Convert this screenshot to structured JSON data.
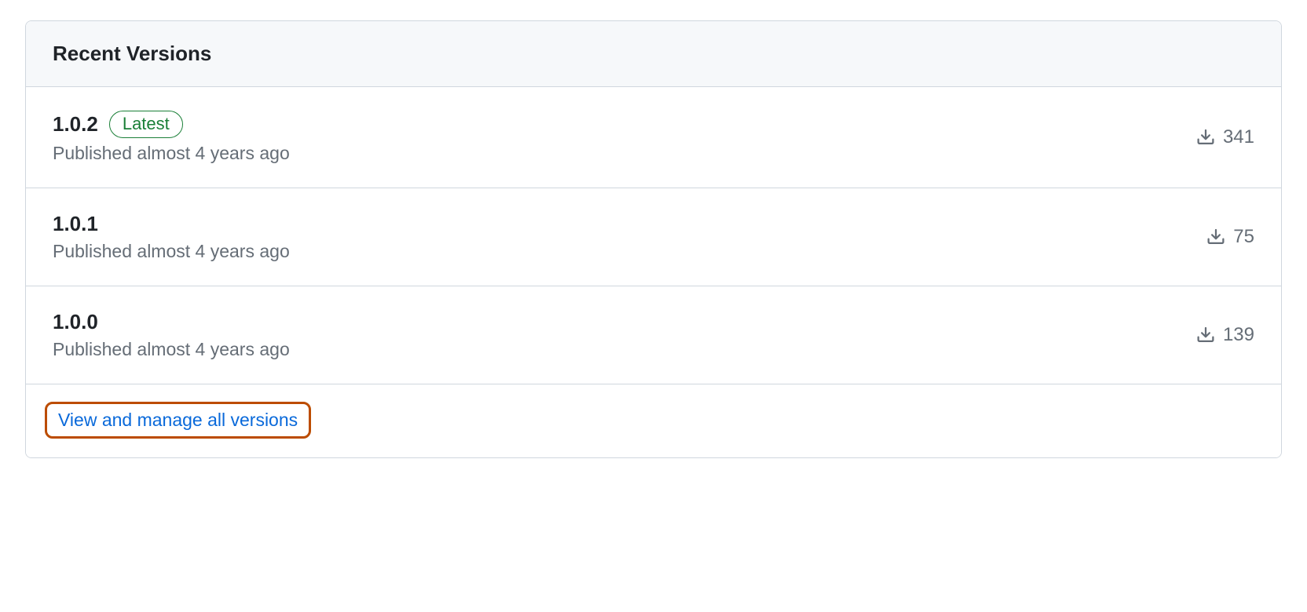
{
  "panel": {
    "title": "Recent Versions",
    "versions": [
      {
        "number": "1.0.2",
        "is_latest": true,
        "latest_label": "Latest",
        "published": "Published almost 4 years ago",
        "downloads": "341"
      },
      {
        "number": "1.0.1",
        "is_latest": false,
        "published": "Published almost 4 years ago",
        "downloads": "75"
      },
      {
        "number": "1.0.0",
        "is_latest": false,
        "published": "Published almost 4 years ago",
        "downloads": "139"
      }
    ],
    "view_all_label": "View and manage all versions"
  }
}
